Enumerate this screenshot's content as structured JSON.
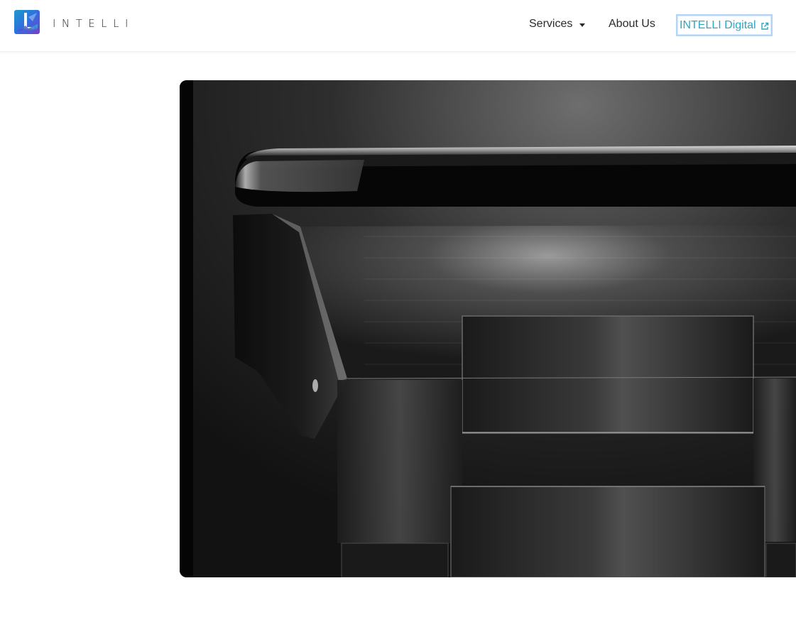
{
  "brand": {
    "name": "INTELLI",
    "logo_icon": "intelli-logo-icon",
    "logo_colors": [
      "#2f6fe0",
      "#7a3cc8",
      "#1c9ac9"
    ]
  },
  "nav": {
    "services_label": "Services",
    "about_label": "About Us",
    "digital_label": "INTELLI Digital",
    "digital_icon": "external-link-icon",
    "services_icon": "caret-down-icon",
    "accent_color": "#2aa7c4"
  },
  "hero": {
    "image_icon": "watch-closeup-image",
    "tone": "monochrome"
  }
}
